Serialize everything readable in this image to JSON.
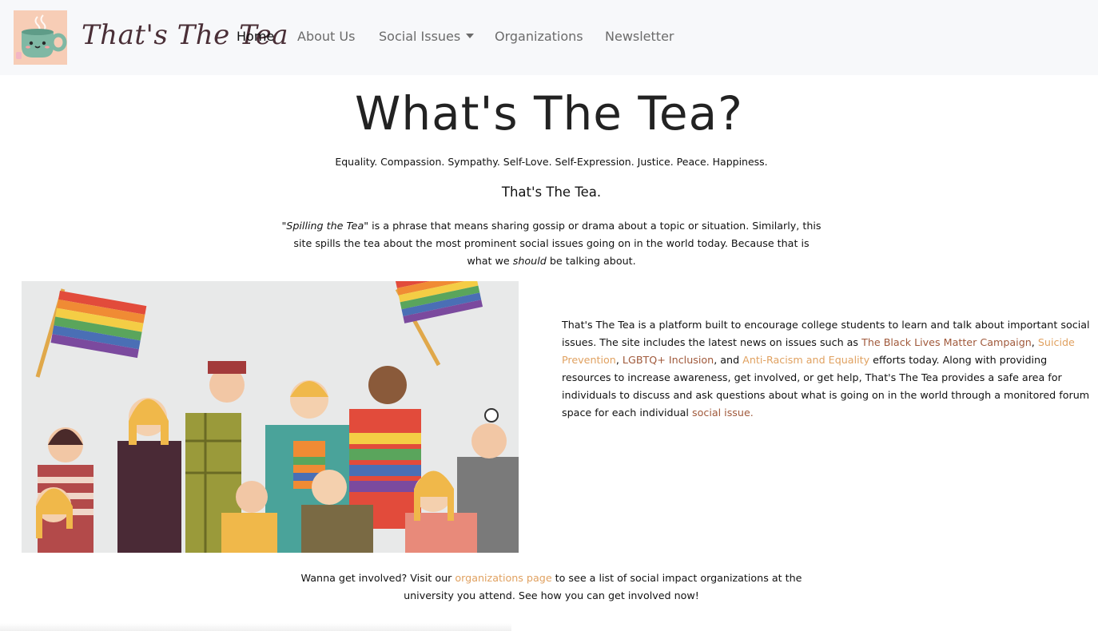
{
  "nav": {
    "brand": "That's The Tea",
    "items": [
      {
        "label": "Home"
      },
      {
        "label": "About Us"
      },
      {
        "label": "Social Issues"
      },
      {
        "label": "Organizations"
      },
      {
        "label": "Newsletter"
      }
    ]
  },
  "hero": {
    "title": "What's The Tea?",
    "tagline": "Equality. Compassion. Sympathy. Self-Love. Self-Expression. Justice. Peace. Happiness.",
    "subtitle": "That's The Tea.",
    "intro": {
      "quote": "\"Spilling the Tea\"",
      "text1": " is a phrase that means sharing gossip or drama about a topic or situation. Similarly, this site spills the tea about the most prominent social issues going on in the world today. Because that is what we ",
      "emphasis": "should",
      "text2": " be talking about."
    }
  },
  "about": {
    "text1": "That's The Tea is a platform built to encourage college students to learn and talk about important social issues. The site includes the latest news on issues such as ",
    "link_blm": "The Black Lives Matter Campaign",
    "sep1": ", ",
    "link_suicide": "Suicide Prevention",
    "sep2": ", ",
    "link_lgbtq": "LGBTQ+ Inclusion",
    "sep3": ", and ",
    "link_antiracism": "Anti-Racism and Equality",
    "text2": " efforts today. Along with providing resources to increase awareness, get involved, or get help, That's The Tea provides a safe area for individuals to discuss and ask questions about what is going on in the world through a monitored forum space for each individual ",
    "link_social": "social issue."
  },
  "involve": {
    "text1": "Wanna get involved? Visit our ",
    "link": "organizations page",
    "text2": " to see a list of social impact organizations at the university you attend. See how you can get involved now!"
  },
  "colors": {
    "brand": "#4a2f37",
    "link_dark": "#a0593b",
    "link_light": "#e0a160",
    "logo_bg": "#f7cdb6",
    "mug": "#7fb8a4"
  }
}
